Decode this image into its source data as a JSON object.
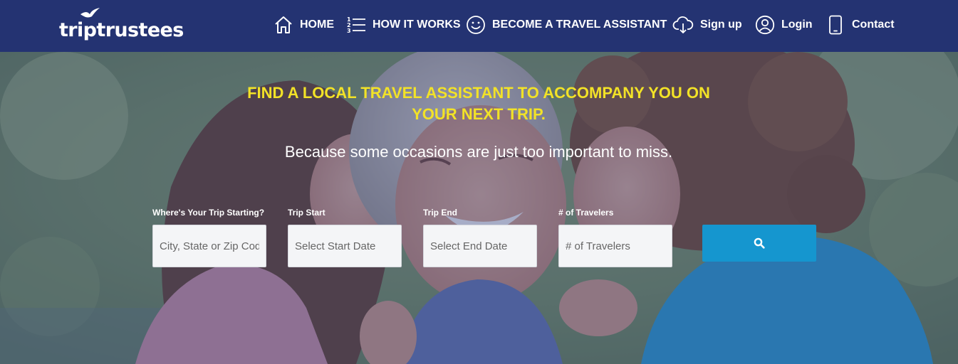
{
  "brand": {
    "logo_text": "triptrustees"
  },
  "nav": {
    "items": [
      {
        "label": "HOME",
        "icon": "home-icon"
      },
      {
        "label": "HOW IT WORKS",
        "icon": "list-icon"
      },
      {
        "label": "BECOME A TRAVEL ASSISTANT",
        "icon": "smiley-icon"
      },
      {
        "label": "Sign up",
        "icon": "cloud-download-icon"
      },
      {
        "label": "Login",
        "icon": "user-icon"
      },
      {
        "label": "Contact",
        "icon": "phone-icon"
      }
    ]
  },
  "hero": {
    "headline_line1": "FIND A LOCAL TRAVEL ASSISTANT TO ACCOMPANY YOU ON",
    "headline_line2": "YOUR NEXT TRIP.",
    "subheadline": "Because some occasions are just too important to miss."
  },
  "search_form": {
    "start_location": {
      "label": "Where's Your Trip Starting?",
      "placeholder": "City, State or Zip Code",
      "value": ""
    },
    "trip_start": {
      "label": "Trip Start",
      "placeholder": "Select Start Date",
      "value": ""
    },
    "trip_end": {
      "label": "Trip End",
      "placeholder": "Select End Date",
      "value": ""
    },
    "travelers": {
      "label": "# of Travelers",
      "placeholder": "# of Travelers",
      "value": ""
    },
    "search_button_icon": "search-icon"
  },
  "colors": {
    "navbar": "#243372",
    "headline": "#f2e227",
    "search_button": "#1596cf"
  }
}
